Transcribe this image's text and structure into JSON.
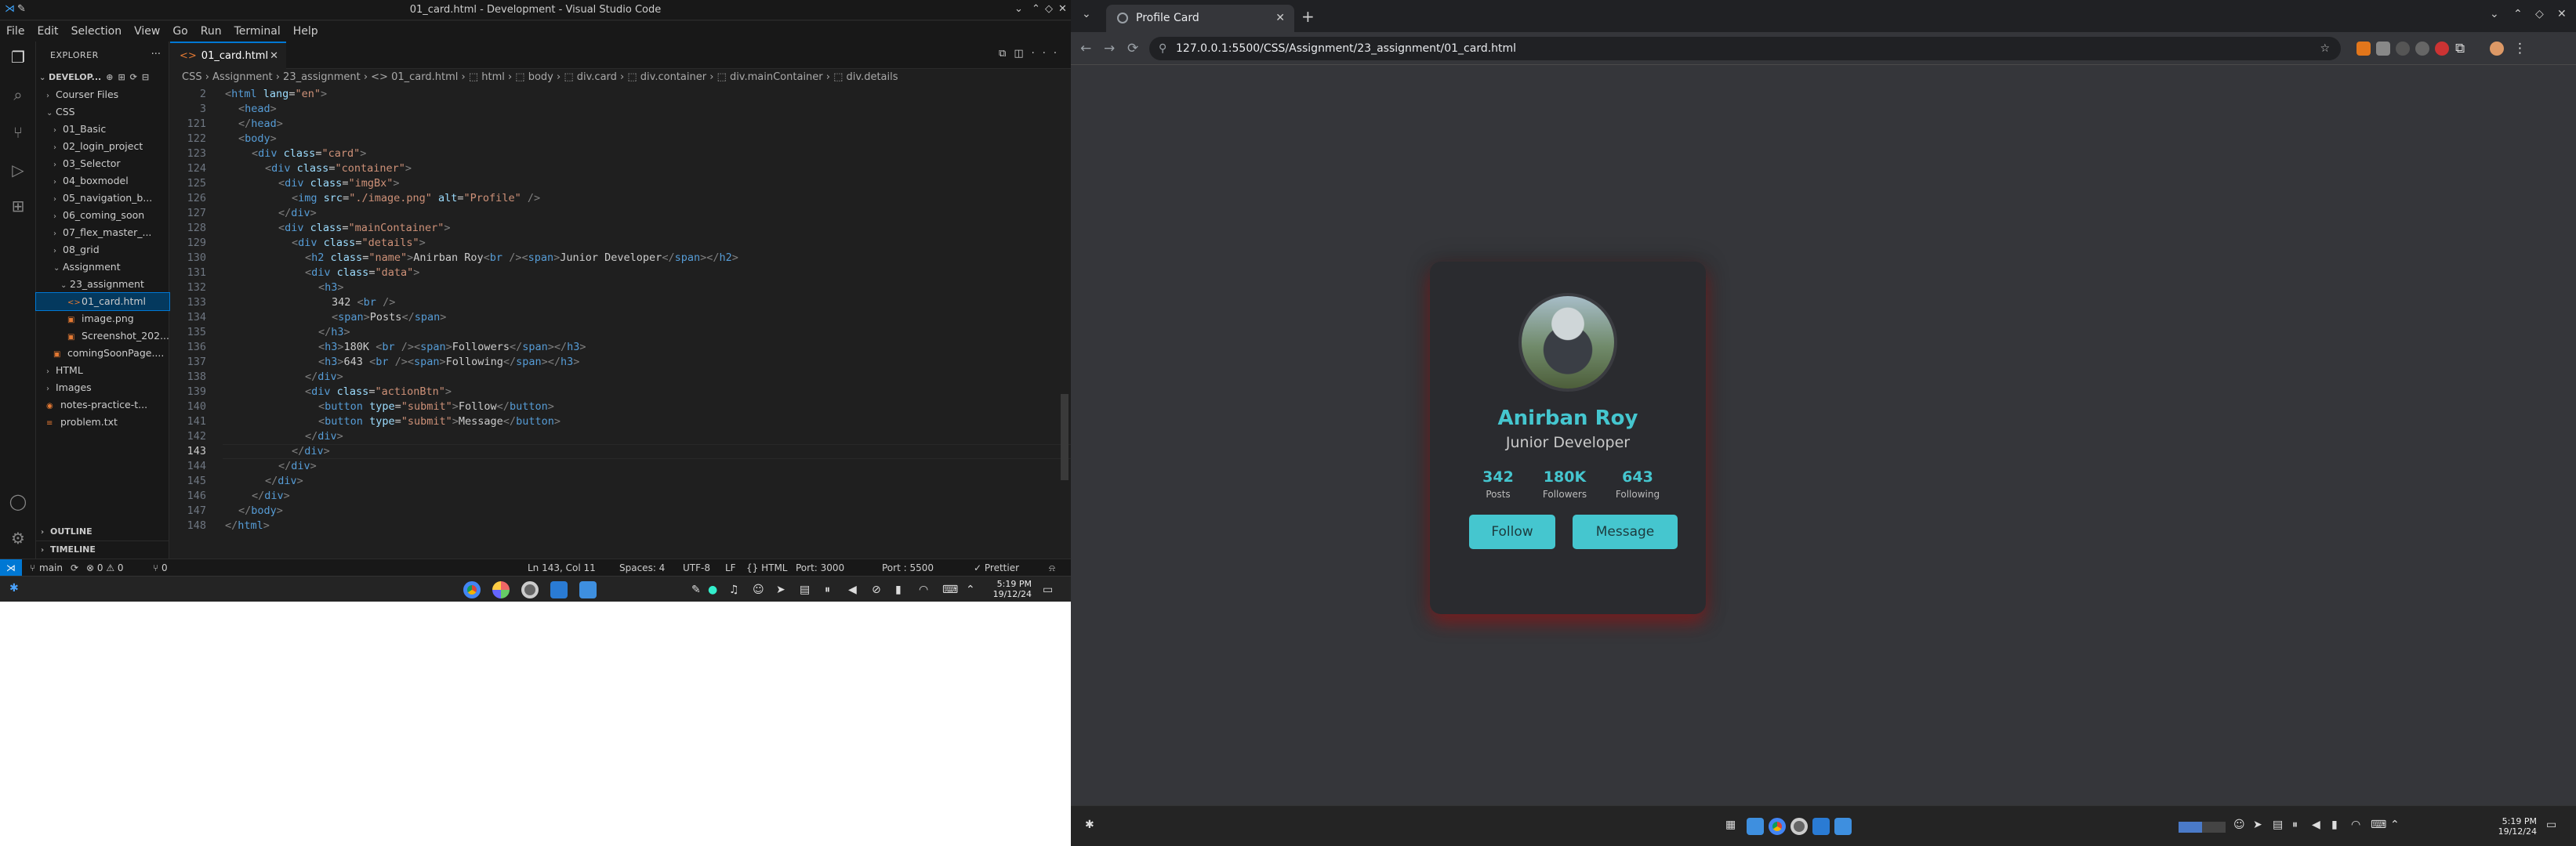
{
  "vscode": {
    "window_title": "01_card.html - Development - Visual Studio Code",
    "menu": [
      "File",
      "Edit",
      "Selection",
      "View",
      "Go",
      "Run",
      "Terminal",
      "Help"
    ],
    "explorer": {
      "header": "EXPLORER",
      "root": "DEVELOP...",
      "items": [
        {
          "label": "Courser Files",
          "depth": 1,
          "folder": true,
          "open": false
        },
        {
          "label": "CSS",
          "depth": 1,
          "folder": true,
          "open": true
        },
        {
          "label": "01_Basic",
          "depth": 2,
          "folder": true,
          "open": false
        },
        {
          "label": "02_login_project",
          "depth": 2,
          "folder": true,
          "open": false
        },
        {
          "label": "03_Selector",
          "depth": 2,
          "folder": true,
          "open": false
        },
        {
          "label": "04_boxmodel",
          "depth": 2,
          "folder": true,
          "open": false
        },
        {
          "label": "05_navigation_b...",
          "depth": 2,
          "folder": true,
          "open": false
        },
        {
          "label": "06_coming_soon",
          "depth": 2,
          "folder": true,
          "open": false
        },
        {
          "label": "07_flex_master_...",
          "depth": 2,
          "folder": true,
          "open": false
        },
        {
          "label": "08_grid",
          "depth": 2,
          "folder": true,
          "open": false
        },
        {
          "label": "Assignment",
          "depth": 2,
          "folder": true,
          "open": true
        },
        {
          "label": "23_assignment",
          "depth": 3,
          "folder": true,
          "open": true
        },
        {
          "label": "01_card.html",
          "depth": 4,
          "folder": false,
          "icon": "<>",
          "selected": true
        },
        {
          "label": "image.png",
          "depth": 4,
          "folder": false,
          "icon": "▣"
        },
        {
          "label": "Screenshot_202...",
          "depth": 4,
          "folder": false,
          "icon": "▣"
        },
        {
          "label": "comingSoonPage....",
          "depth": 2,
          "folder": false,
          "icon": "▣"
        },
        {
          "label": "HTML",
          "depth": 1,
          "folder": true,
          "open": false
        },
        {
          "label": "Images",
          "depth": 1,
          "folder": true,
          "open": false
        },
        {
          "label": "notes-practice-t...",
          "depth": 1,
          "folder": false,
          "icon": "◉"
        },
        {
          "label": "problem.txt",
          "depth": 1,
          "folder": false,
          "icon": "≡"
        }
      ],
      "outline": "OUTLINE",
      "timeline": "TIMELINE"
    },
    "tab": {
      "label": "01_card.html",
      "icon": "<>"
    },
    "breadcrumb": "CSS › Assignment › 23_assignment › <> 01_card.html › ⬚ html › ⬚ body › ⬚ div.card › ⬚ div.container › ⬚ div.mainContainer › ⬚ div.details",
    "code_lines": [
      {
        "n": "2",
        "t": "<html lang=\"en\">",
        "i": 0
      },
      {
        "n": "3",
        "t": "<head>",
        "i": 1
      },
      {
        "n": "121",
        "t": "</head>",
        "i": 1
      },
      {
        "n": "122",
        "t": "<body>",
        "i": 1
      },
      {
        "n": "123",
        "t": "<div class=\"card\">",
        "i": 2
      },
      {
        "n": "124",
        "t": "<div class=\"container\">",
        "i": 3
      },
      {
        "n": "125",
        "t": "<div class=\"imgBx\">",
        "i": 4
      },
      {
        "n": "126",
        "t": "<img src=\"./image.png\" alt=\"Profile\" />",
        "i": 5
      },
      {
        "n": "127",
        "t": "</div>",
        "i": 4
      },
      {
        "n": "128",
        "t": "<div class=\"mainContainer\">",
        "i": 4
      },
      {
        "n": "129",
        "t": "<div class=\"details\">",
        "i": 5
      },
      {
        "n": "130",
        "t": "<h2 class=\"name\">Anirban Roy<br /><span>Junior Developer</span></h2>",
        "i": 6
      },
      {
        "n": "131",
        "t": "<div class=\"data\">",
        "i": 6
      },
      {
        "n": "132",
        "t": "<h3>",
        "i": 7
      },
      {
        "n": "133",
        "t": "342 <br />",
        "i": 8
      },
      {
        "n": "134",
        "t": "<span>Posts</span>",
        "i": 8
      },
      {
        "n": "135",
        "t": "</h3>",
        "i": 7
      },
      {
        "n": "136",
        "t": "<h3>180K <br /><span>Followers</span></h3>",
        "i": 7
      },
      {
        "n": "137",
        "t": "<h3>643 <br /><span>Following</span></h3>",
        "i": 7
      },
      {
        "n": "138",
        "t": "</div>",
        "i": 6
      },
      {
        "n": "139",
        "t": "<div class=\"actionBtn\">",
        "i": 6
      },
      {
        "n": "140",
        "t": "<button type=\"submit\">Follow</button>",
        "i": 7
      },
      {
        "n": "141",
        "t": "<button type=\"submit\">Message</button>",
        "i": 7
      },
      {
        "n": "142",
        "t": "</div>",
        "i": 6
      },
      {
        "n": "143",
        "t": "</div>",
        "i": 5,
        "current": true
      },
      {
        "n": "144",
        "t": "</div>",
        "i": 4
      },
      {
        "n": "145",
        "t": "</div>",
        "i": 3
      },
      {
        "n": "146",
        "t": "</div>",
        "i": 2
      },
      {
        "n": "147",
        "t": "</body>",
        "i": 1
      },
      {
        "n": "148",
        "t": "</html>",
        "i": 0
      }
    ],
    "status": {
      "branch": "main",
      "sync": "⟳",
      "problems": "⊗ 0 ⚠ 0",
      "ports": "⑂ 0",
      "position": "Ln 143, Col 11",
      "spaces": "Spaces: 4",
      "encoding": "UTF-8",
      "eol": "LF",
      "language": "{} HTML",
      "port1": "Port: 3000",
      "port2": "Port : 5500",
      "prettier": "✓ Prettier"
    },
    "clock": {
      "time": "5:19 PM",
      "date": "19/12/24"
    }
  },
  "chrome": {
    "tab_title": "Profile Card",
    "url": "127.0.0.1:5500/CSS/Assignment/23_assignment/01_card.html",
    "clock": {
      "time": "5:19 PM",
      "date": "19/12/24"
    }
  },
  "card": {
    "name": "Anirban Roy",
    "role": "Junior Developer",
    "stats": [
      {
        "value": "342",
        "label": "Posts"
      },
      {
        "value": "180K",
        "label": "Followers"
      },
      {
        "value": "643",
        "label": "Following"
      }
    ],
    "follow_label": "Follow",
    "message_label": "Message",
    "accent": "#45c6cf"
  }
}
